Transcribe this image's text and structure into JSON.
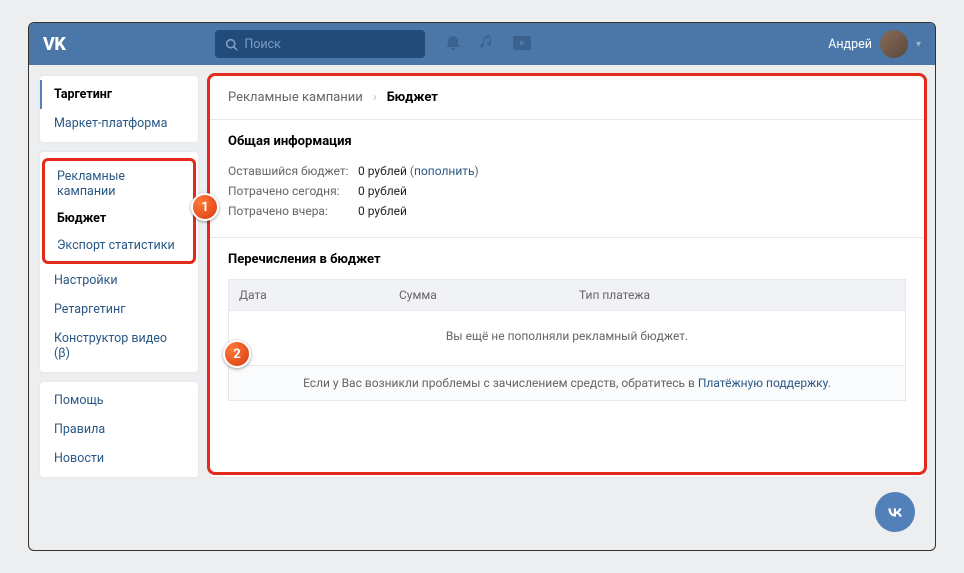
{
  "header": {
    "logo": "VK",
    "search_placeholder": "Поиск",
    "user_name": "Андрей"
  },
  "sidebar": {
    "group1": [
      {
        "label": "Таргетинг",
        "active": true
      },
      {
        "label": "Маркет-платформа",
        "active": false
      }
    ],
    "group2": [
      {
        "label": "Рекламные кампании",
        "sel": false
      },
      {
        "label": "Бюджет",
        "sel": true
      },
      {
        "label": "Экспорт статистики",
        "sel": false
      }
    ],
    "group3": [
      {
        "label": "Настройки"
      },
      {
        "label": "Ретаргетинг"
      },
      {
        "label": "Конструктор видео (β)"
      }
    ],
    "group4": [
      {
        "label": "Помощь"
      },
      {
        "label": "Правила"
      },
      {
        "label": "Новости"
      }
    ]
  },
  "breadcrumb": {
    "parent": "Рекламные кампании",
    "current": "Бюджет"
  },
  "info": {
    "title": "Общая информация",
    "rows": [
      {
        "k": "Оставшийся бюджет:",
        "v": "0 рублей",
        "link": "пополнить"
      },
      {
        "k": "Потрачено сегодня:",
        "v": "0 рублей"
      },
      {
        "k": "Потрачено вчера:",
        "v": "0 рублей"
      }
    ]
  },
  "transfers": {
    "title": "Перечисления в бюджет",
    "columns": [
      "Дата",
      "Сумма",
      "Тип платежа"
    ],
    "empty": "Вы ещё не пополняли рекламный бюджет.",
    "footer_prefix": "Если у Вас возникли проблемы с зачислением средств, обратитесь в ",
    "footer_link": "Платёжную поддержку",
    "footer_suffix": "."
  },
  "callouts": {
    "one": "1",
    "two": "2"
  }
}
